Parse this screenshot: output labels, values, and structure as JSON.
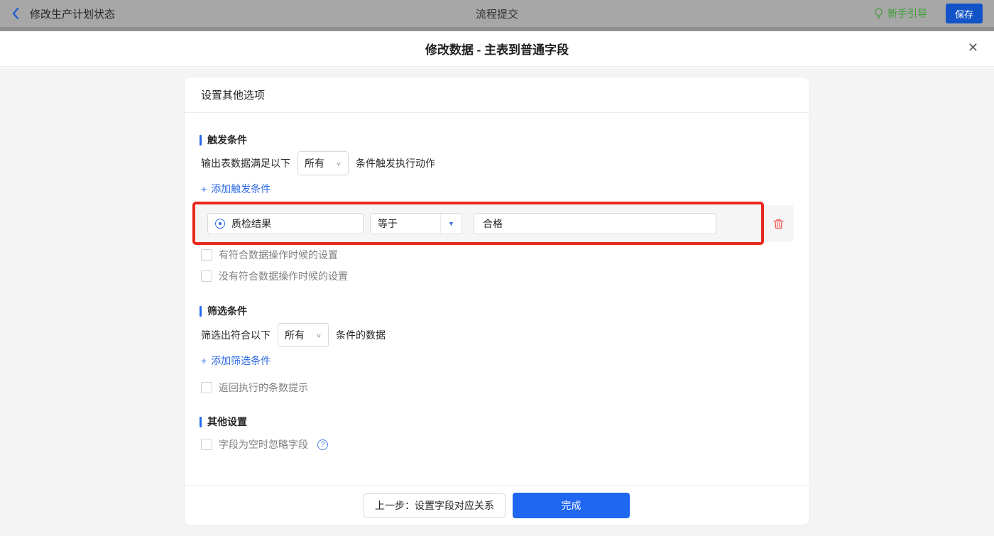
{
  "topbar": {
    "back_title": "修改生产计划状态",
    "center_title": "流程提交",
    "guide_label": "新手引导",
    "save_label": "保存"
  },
  "dialog": {
    "title": "修改数据 - 主表到普通字段"
  },
  "card": {
    "header": "设置其他选项",
    "trigger_section": {
      "title": "触发条件",
      "sentence_prefix": "输出表数据满足以下",
      "match_select_value": "所有",
      "sentence_suffix": "条件触发执行动作",
      "add_link_label": "添加触发条件",
      "condition": {
        "field": "质检结果",
        "operator": "等于",
        "value": "合格"
      },
      "checkbox_has_match": "有符合数据操作时候的设置",
      "checkbox_no_match": "没有符合数据操作时候的设置"
    },
    "filter_section": {
      "title": "筛选条件",
      "sentence_prefix": "筛选出符合以下",
      "match_select_value": "所有",
      "sentence_suffix": "条件的数据",
      "add_link_label": "添加筛选条件",
      "checkbox_return_count": "返回执行的条数提示"
    },
    "other_section": {
      "title": "其他设置",
      "checkbox_ignore_empty": "字段为空时忽略字段"
    },
    "footer": {
      "prev_label": "上一步：设置字段对应关系",
      "done_label": "完成"
    }
  },
  "icons": {
    "plus": "+",
    "chevron_down": "∨",
    "caret_down": "▼",
    "close": "✕",
    "question": "?"
  },
  "colors": {
    "primary_blue": "#1f66f0",
    "link_blue": "#2f6be4",
    "topbar_save_blue": "#1254c8",
    "guide_green": "#3f9e36",
    "annotation_red": "#e8291d",
    "trash_red": "#f05a5a",
    "accent_bar_blue": "#2468f2",
    "page_gray": "#f4f4f4",
    "row_gray": "#f5f5f5"
  }
}
